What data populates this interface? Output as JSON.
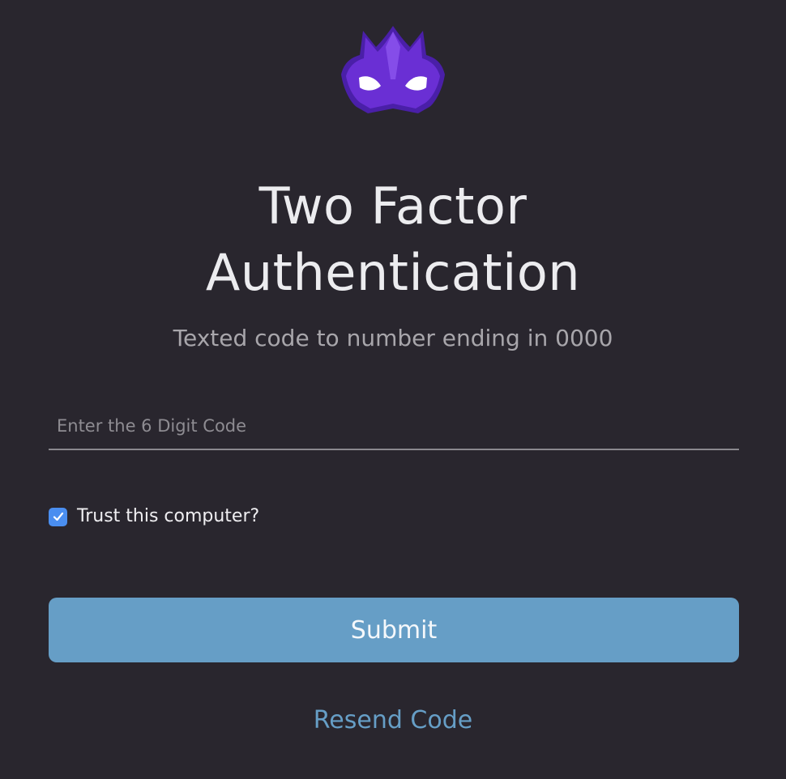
{
  "brand": {
    "logo_icon": "purple-mask-logo-icon",
    "primary_color": "#6a2fd4",
    "eye_color": "#ffffff"
  },
  "header": {
    "title_line1": "Two Factor",
    "title_line2": "Authentication",
    "subtitle": "Texted code to number ending in 0000"
  },
  "form": {
    "code_placeholder": "Enter the 6 Digit Code",
    "code_value": "",
    "trust_label": "Trust this computer?",
    "trust_checked": true,
    "submit_label": "Submit",
    "resend_label": "Resend Code"
  },
  "colors": {
    "background": "#29262e",
    "accent": "#669ec6",
    "checkbox": "#4a8ef0"
  }
}
